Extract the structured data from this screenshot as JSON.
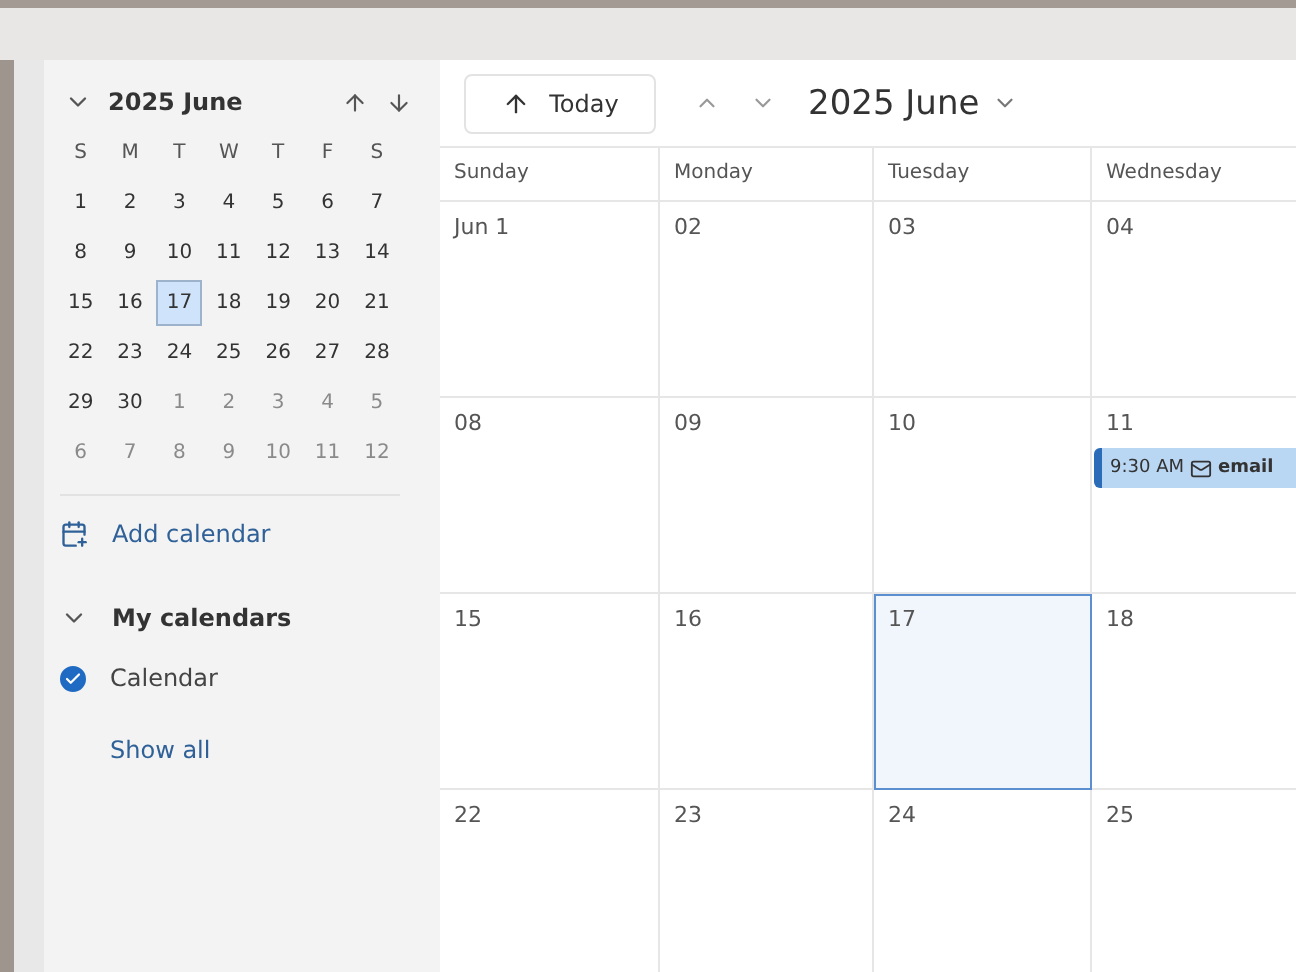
{
  "mini_calendar": {
    "title": "2025 June",
    "expanded": true,
    "weekdays": [
      "S",
      "M",
      "T",
      "W",
      "T",
      "F",
      "S"
    ],
    "weeks": [
      [
        {
          "day": "1",
          "in_month": true,
          "selected": false
        },
        {
          "day": "2",
          "in_month": true,
          "selected": false
        },
        {
          "day": "3",
          "in_month": true,
          "selected": false
        },
        {
          "day": "4",
          "in_month": true,
          "selected": false
        },
        {
          "day": "5",
          "in_month": true,
          "selected": false
        },
        {
          "day": "6",
          "in_month": true,
          "selected": false
        },
        {
          "day": "7",
          "in_month": true,
          "selected": false
        }
      ],
      [
        {
          "day": "8",
          "in_month": true,
          "selected": false
        },
        {
          "day": "9",
          "in_month": true,
          "selected": false
        },
        {
          "day": "10",
          "in_month": true,
          "selected": false
        },
        {
          "day": "11",
          "in_month": true,
          "selected": false
        },
        {
          "day": "12",
          "in_month": true,
          "selected": false
        },
        {
          "day": "13",
          "in_month": true,
          "selected": false
        },
        {
          "day": "14",
          "in_month": true,
          "selected": false
        }
      ],
      [
        {
          "day": "15",
          "in_month": true,
          "selected": false
        },
        {
          "day": "16",
          "in_month": true,
          "selected": false
        },
        {
          "day": "17",
          "in_month": true,
          "selected": true
        },
        {
          "day": "18",
          "in_month": true,
          "selected": false
        },
        {
          "day": "19",
          "in_month": true,
          "selected": false
        },
        {
          "day": "20",
          "in_month": true,
          "selected": false
        },
        {
          "day": "21",
          "in_month": true,
          "selected": false
        }
      ],
      [
        {
          "day": "22",
          "in_month": true,
          "selected": false
        },
        {
          "day": "23",
          "in_month": true,
          "selected": false
        },
        {
          "day": "24",
          "in_month": true,
          "selected": false
        },
        {
          "day": "25",
          "in_month": true,
          "selected": false
        },
        {
          "day": "26",
          "in_month": true,
          "selected": false
        },
        {
          "day": "27",
          "in_month": true,
          "selected": false
        },
        {
          "day": "28",
          "in_month": true,
          "selected": false
        }
      ],
      [
        {
          "day": "29",
          "in_month": true,
          "selected": false
        },
        {
          "day": "30",
          "in_month": true,
          "selected": false
        },
        {
          "day": "1",
          "in_month": false,
          "selected": false
        },
        {
          "day": "2",
          "in_month": false,
          "selected": false
        },
        {
          "day": "3",
          "in_month": false,
          "selected": false
        },
        {
          "day": "4",
          "in_month": false,
          "selected": false
        },
        {
          "day": "5",
          "in_month": false,
          "selected": false
        }
      ],
      [
        {
          "day": "6",
          "in_month": false,
          "selected": false
        },
        {
          "day": "7",
          "in_month": false,
          "selected": false
        },
        {
          "day": "8",
          "in_month": false,
          "selected": false
        },
        {
          "day": "9",
          "in_month": false,
          "selected": false
        },
        {
          "day": "10",
          "in_month": false,
          "selected": false
        },
        {
          "day": "11",
          "in_month": false,
          "selected": false
        },
        {
          "day": "12",
          "in_month": false,
          "selected": false
        }
      ]
    ]
  },
  "add_calendar": "Add calendar",
  "my_calendars": {
    "title": "My calendars",
    "expanded": true,
    "items": [
      {
        "name": "Calendar",
        "checked": true
      }
    ]
  },
  "show_all": "Show all",
  "toolbar": {
    "today": "Today",
    "title": "2025 June"
  },
  "month_view": {
    "columns": [
      "Sunday",
      "Monday",
      "Tuesday",
      "Wednesday"
    ],
    "weeks": [
      [
        {
          "date": "Jun 1",
          "selected": false
        },
        {
          "date": "02",
          "selected": false
        },
        {
          "date": "03",
          "selected": false
        },
        {
          "date": "04",
          "selected": false
        }
      ],
      [
        {
          "date": "08",
          "selected": false
        },
        {
          "date": "09",
          "selected": false
        },
        {
          "date": "10",
          "selected": false
        },
        {
          "date": "11",
          "selected": false,
          "events": [
            {
              "time": "9:30 AM",
              "title": "email"
            }
          ]
        }
      ],
      [
        {
          "date": "15",
          "selected": false
        },
        {
          "date": "16",
          "selected": false
        },
        {
          "date": "17",
          "selected": true
        },
        {
          "date": "18",
          "selected": false
        }
      ],
      [
        {
          "date": "22",
          "selected": false
        },
        {
          "date": "23",
          "selected": false
        },
        {
          "date": "24",
          "selected": false
        },
        {
          "date": "25",
          "selected": false
        }
      ]
    ]
  }
}
